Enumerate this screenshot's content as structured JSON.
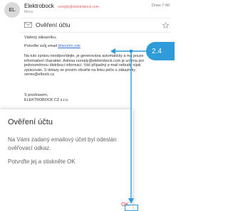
{
  "email": {
    "avatar_initials": "EL",
    "sender_name": "Elektrobock",
    "sender_email": "noreply@elektrobock.com",
    "date": "Dnes 7:40",
    "recipient": "Mnou",
    "subject": "Ověření účtu",
    "greeting": "Vážený zákazníku,",
    "confirm_text": "Potvrďte svůj email ",
    "confirm_link": "kliknutím zde",
    "notice": "Na tuto zprávu neodpovídejte, je generována automaticky a má pouze informativní charakter. Adresa noreply@elektrobock.com je určena pro jednosměrnou distribuci informací. Váš případný e-mail nebude nijak zpracován. S dotazy se prosím obraťte na linku péče o zákazníky servis@elbock.cz.",
    "signoff_1": "S pozdravem,",
    "signoff_2": "ELEKTROBOCK CZ s.r.o."
  },
  "callout": {
    "label": "2.4",
    "color": "#2f9bd8"
  },
  "dialog": {
    "title": "Ověření účtu",
    "message": "Na Vámi zadaný emailový účet byl odeslán ověřovací odkaz.",
    "hint": "Potvrďte jej a stiskněte OK",
    "ok_label": "OK",
    "ok_color": "#e53935"
  },
  "icons": {
    "subject": "envelope-icon",
    "favorite": "star-outline-icon"
  }
}
